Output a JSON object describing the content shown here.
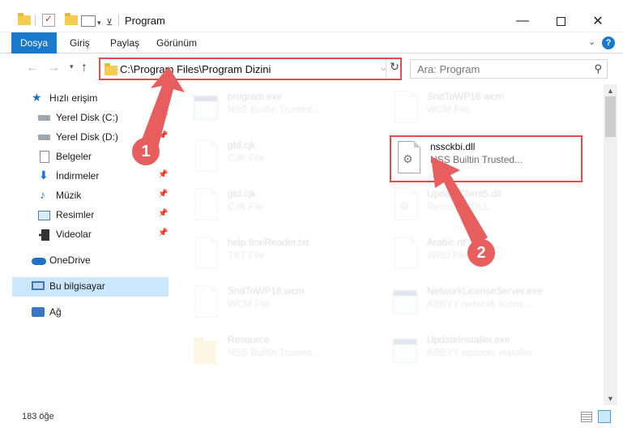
{
  "window": {
    "title": "Program",
    "minimize": "—",
    "close": "✕"
  },
  "ribbon": {
    "tabs": [
      "Dosya",
      "Giriş",
      "Paylaş",
      "Görünüm"
    ],
    "help": "?",
    "chevron": "⌄"
  },
  "nav": {
    "back": "←",
    "forward": "→",
    "recent": "▾",
    "up": "↑",
    "address": "C:\\Program Files\\Program Dizini",
    "dropdown": "⌵",
    "refresh": "↻",
    "search_placeholder": "Ara: Program",
    "search_glyph": "⚲"
  },
  "sidebar": {
    "items": [
      {
        "label": "Hızlı erişim",
        "icon": "star-icon"
      },
      {
        "label": "Yerel Disk (C:)",
        "icon": "drive-icon"
      },
      {
        "label": "Yerel Disk (D:)",
        "icon": "drive-icon"
      },
      {
        "label": "Belgeler",
        "icon": "document-icon"
      },
      {
        "label": "İndirmeler",
        "icon": "download-icon"
      },
      {
        "label": "Müzik",
        "icon": "music-icon"
      },
      {
        "label": "Resimler",
        "icon": "pictures-icon"
      },
      {
        "label": "Videolar",
        "icon": "video-icon"
      },
      {
        "label": "OneDrive",
        "icon": "cloud-icon"
      },
      {
        "label": "Bu bilgisayar",
        "icon": "computer-icon"
      },
      {
        "label": "Ağ",
        "icon": "network-icon"
      }
    ],
    "pin_glyph": "📌"
  },
  "files": [
    {
      "name": "program.exe",
      "type": "NSS Builtin Trusted..."
    },
    {
      "name": "SndToWP16.wcm",
      "type": "WCM File"
    },
    {
      "name": "gtd.cjk",
      "type": "CJK File"
    },
    {
      "name": "nssckbi.dll",
      "type": "NSS Builtin Trusted..."
    },
    {
      "name": "gtd.cjk",
      "type": "CJK File"
    },
    {
      "name": "UpdateClient5.dll",
      "type": "Resource DLL"
    },
    {
      "name": "help.fineReader.txt",
      "type": "TXT File"
    },
    {
      "name": "Arabic.rtf",
      "type": "WRD File"
    },
    {
      "name": "SndToWP18.wcm",
      "type": "WCM File"
    },
    {
      "name": "NetworkLicenseServer.exe",
      "type": "ABBYY network licens..."
    },
    {
      "name": "Resource",
      "type": "NSS Builtin Trusted..."
    },
    {
      "name": "UpdateInstaller.exe",
      "type": "ABBYY updates installer"
    }
  ],
  "gear_glyph": "⚙",
  "scroll": {
    "up": "▲",
    "down": "▼"
  },
  "status": {
    "count": "183 öğe"
  },
  "callouts": [
    "1",
    "2"
  ],
  "colors": {
    "accent": "#1979ca",
    "highlight": "#e74c4c",
    "selected": "#cce8ff"
  }
}
